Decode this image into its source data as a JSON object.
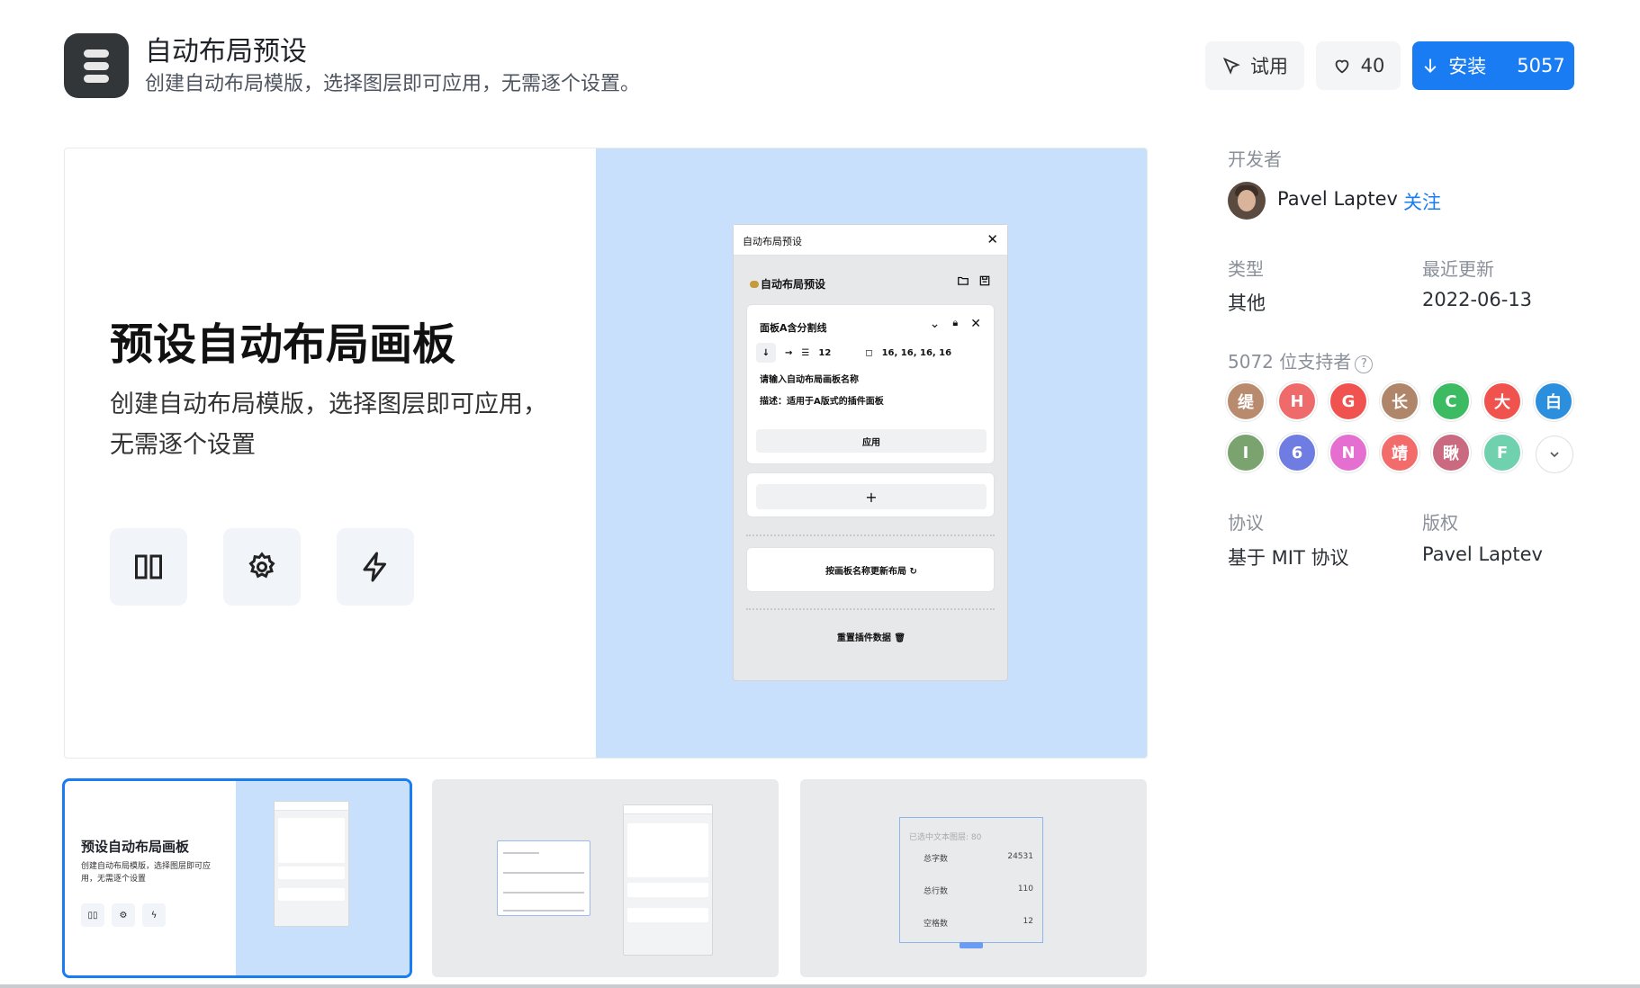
{
  "header": {
    "title": "自动布局预设",
    "subtitle": "创建自动布局模版，选择图层即可应用，无需逐个设置。",
    "try_label": "试用",
    "like_count": "40",
    "install_label": "安装",
    "install_count": "5057",
    "accent_color": "#1a7cf2"
  },
  "preview": {
    "title": "预设自动布局画板",
    "desc": "创建自动布局模版，选择图层即可应用，无需逐个设置",
    "tile_icons": [
      "columns-icon",
      "gear-icon",
      "lightning-icon"
    ],
    "mock": {
      "window_title": "自动布局预设",
      "header": "自动布局预设",
      "card_title": "面板A含分割线",
      "spacing": "12",
      "padding": "16, 16, 16, 16",
      "name_line": "请输入自动布局画板名称",
      "desc_line": "描述：适用于A版式的插件面板",
      "apply": "应用",
      "plus": "+",
      "update": "按画板名称更新布局",
      "reset": "重置插件数据"
    }
  },
  "thumbs": {
    "t1_title": "预设自动布局画板",
    "t1_desc": "创建自动布局模版，选择图层即可应用，无需逐个设置",
    "t3_placeholder": "已选中文本图层: 80",
    "t3_rows": [
      {
        "label": "总字数",
        "value": "24531"
      },
      {
        "label": "总行数",
        "value": "110"
      },
      {
        "label": "空格数",
        "value": "12"
      }
    ]
  },
  "sidebar": {
    "developer_label": "开发者",
    "developer_name": "Pavel Laptev",
    "follow_label": "关注",
    "type_label": "类型",
    "type_value": "其他",
    "updated_label": "最近更新",
    "updated_value": "2022-06-13",
    "supporters_label": "5072 位支持者",
    "supporters": [
      {
        "char": "缇",
        "color": "#b88a6e"
      },
      {
        "char": "H",
        "color": "#ef6b6b"
      },
      {
        "char": "G",
        "color": "#f0524f"
      },
      {
        "char": "长",
        "color": "#b0866a"
      },
      {
        "char": "C",
        "color": "#3dbb63"
      },
      {
        "char": "大",
        "color": "#f0534e"
      },
      {
        "char": "白",
        "color": "#2b8fde"
      },
      {
        "char": "I",
        "color": "#7aa36f"
      },
      {
        "char": "6",
        "color": "#6f7de2"
      },
      {
        "char": "N",
        "color": "#e56fd0"
      },
      {
        "char": "靖",
        "color": "#f26c6c"
      },
      {
        "char": "瞅",
        "color": "#c96a80"
      },
      {
        "char": "F",
        "color": "#6fd1ad"
      }
    ],
    "license_label": "协议",
    "license_value": "基于 MIT 协议",
    "copyright_label": "版权",
    "copyright_value": "Pavel Laptev"
  }
}
